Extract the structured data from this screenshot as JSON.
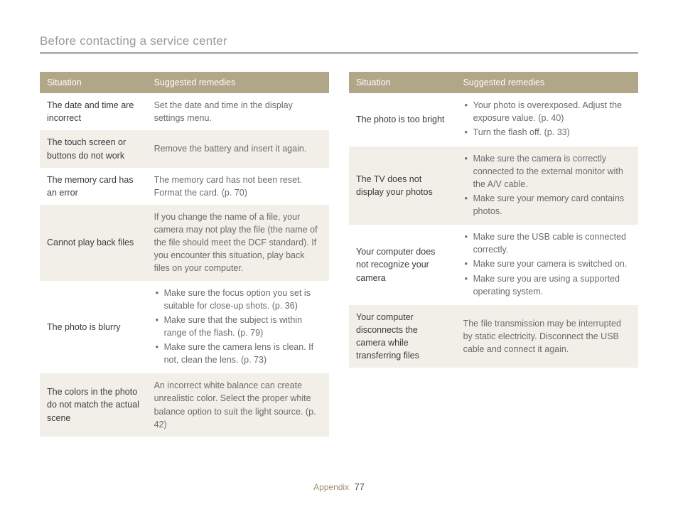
{
  "page_title": "Before contacting a service center",
  "headers": {
    "situation": "Situation",
    "remedies": "Suggested remedies"
  },
  "left_table": [
    {
      "situation": "The date and time are incorrect",
      "remedy_text": "Set the date and time in the display settings menu."
    },
    {
      "situation": "The touch screen or buttons do not work",
      "remedy_text": "Remove the battery and insert it again."
    },
    {
      "situation": "The memory card has an error",
      "remedy_text": "The memory card has not been reset. Format the card. (p. 70)"
    },
    {
      "situation": "Cannot play back files",
      "remedy_text": "If you change the name of a file, your camera may not play the file (the name of the file should meet the DCF standard). If you encounter this situation, play back files on your computer."
    },
    {
      "situation": "The photo is blurry",
      "remedy_list": [
        "Make sure the focus option you set is suitable for close-up shots. (p. 36)",
        "Make sure that the subject is within range of the flash. (p. 79)",
        "Make sure the camera lens is clean. If not, clean the lens. (p. 73)"
      ]
    },
    {
      "situation": "The colors in the photo do not match the actual scene",
      "remedy_text": "An incorrect white balance can create unrealistic color. Select the proper white balance option to suit the light source. (p. 42)"
    }
  ],
  "right_table": [
    {
      "situation": "The photo is too bright",
      "remedy_list": [
        "Your photo is overexposed. Adjust the exposure value. (p. 40)",
        "Turn the flash off. (p. 33)"
      ]
    },
    {
      "situation": "The TV does not display your photos",
      "remedy_list": [
        "Make sure the camera is correctly connected to the external monitor with the A/V cable.",
        "Make sure your memory card contains photos."
      ]
    },
    {
      "situation": "Your computer does not recognize your camera",
      "remedy_list": [
        "Make sure the USB cable is connected correctly.",
        "Make sure your camera is switched on.",
        "Make sure you are using a supported operating system."
      ]
    },
    {
      "situation": "Your computer disconnects the camera while transferring files",
      "remedy_text": "The file transmission may be interrupted by static electricity. Disconnect the USB cable and connect it again."
    }
  ],
  "footer": {
    "section": "Appendix",
    "page": "77"
  }
}
